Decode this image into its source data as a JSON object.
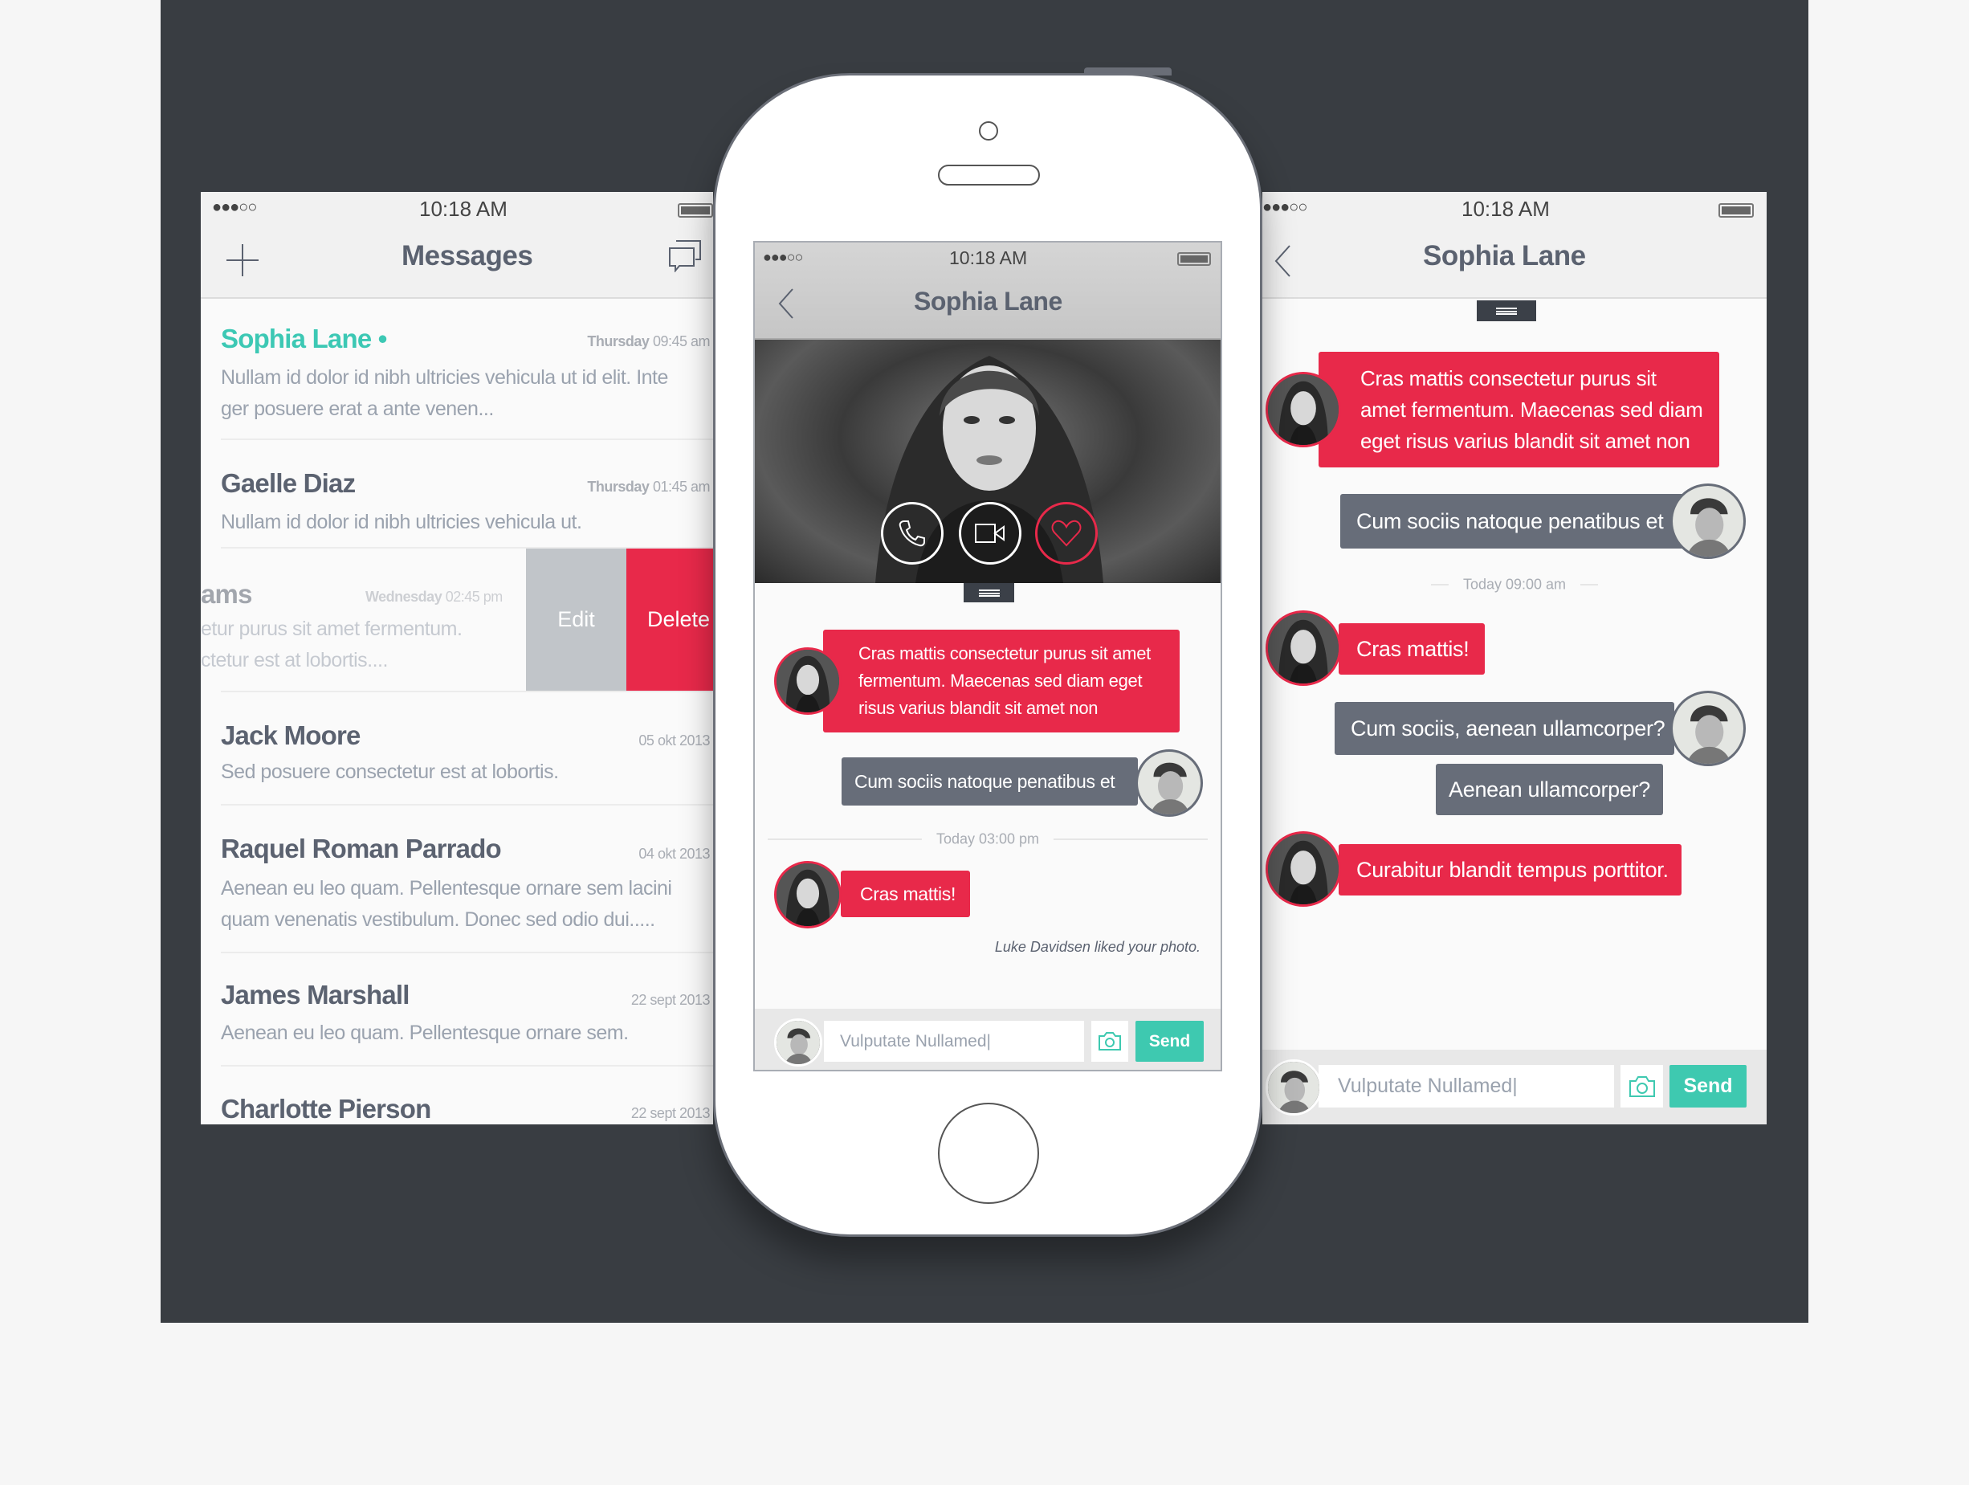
{
  "colors": {
    "accent": "#e8294a",
    "teal": "#3ec9b0",
    "bubble_gray": "#676d79",
    "backdrop": "#393d42"
  },
  "status": {
    "signal": "●●●○○",
    "time": "10:18 AM"
  },
  "left": {
    "title": "Messages",
    "add_icon": "plus-icon",
    "compose_icon": "chat-bubbles-icon",
    "items": [
      {
        "name": "Sophia Lane",
        "online": "•",
        "day": "Thursday",
        "time": " 09:45 am",
        "preview": [
          "Nullam id dolor id nibh ultricies vehicula ut id elit. Inte",
          "ger posuere erat a ante venen..."
        ]
      },
      {
        "name": "Gaelle Diaz",
        "day": "Thursday",
        "time": " 01:45 am",
        "preview": [
          "Nullam id dolor id nibh ultricies vehicula ut."
        ]
      },
      {
        "name": "ams",
        "day": "Wednesday",
        "time": " 02:45 pm",
        "preview": [
          "etur purus sit amet fermentum.",
          "ctetur est at lobortis...."
        ]
      },
      {
        "name": "Jack Moore",
        "date": "05 okt 2013",
        "preview": [
          "Sed posuere consectetur est at lobortis."
        ]
      },
      {
        "name": "Raquel Roman Parrado",
        "date": "04 okt 2013",
        "preview": [
          "Aenean eu leo quam. Pellentesque ornare sem lacini",
          "quam venenatis vestibulum. Donec sed odio dui....."
        ]
      },
      {
        "name": "James Marshall",
        "date": "22 sept 2013",
        "preview": [
          "Aenean eu leo quam. Pellentesque ornare sem."
        ]
      },
      {
        "name": "Charlotte Pierson",
        "date": "22 sept 2013"
      }
    ],
    "swipe_actions": {
      "edit": "Edit",
      "delete": "Delete"
    }
  },
  "center": {
    "title": "Sophia Lane",
    "actions": [
      "phone-icon",
      "video-camera-icon",
      "heart-icon"
    ],
    "messages": [
      {
        "from": "her",
        "text": "Cras mattis consectetur purus sit amet fermentum. Maecenas sed diam eget risus varius blandit sit amet non"
      },
      {
        "from": "me",
        "text": "Cum sociis natoque penatibus et"
      },
      {
        "separator": "Today 03:00 pm"
      },
      {
        "from": "her",
        "text": "Cras mattis!"
      }
    ],
    "notice": "Luke Davidsen liked your photo.",
    "input": {
      "value": "Vulputate Nullamed|",
      "send": "Send"
    }
  },
  "right": {
    "title": "Sophia Lane",
    "messages": [
      {
        "from": "her",
        "text": "Cras mattis consectetur purus sit amet fermentum. Maecenas sed diam eget risus varius blandit sit amet non"
      },
      {
        "from": "me",
        "text": "Cum sociis natoque penatibus et"
      },
      {
        "separator": "Today 09:00 am"
      },
      {
        "from": "her",
        "text": "Cras mattis!"
      },
      {
        "from": "me",
        "text": "Cum sociis, aenean ullamcorper?"
      },
      {
        "from": "me",
        "text": "Aenean ullamcorper?"
      },
      {
        "from": "her",
        "text": "Curabitur blandit tempus porttitor."
      }
    ],
    "input": {
      "value": "Vulputate Nullamed|",
      "send": "Send"
    }
  }
}
